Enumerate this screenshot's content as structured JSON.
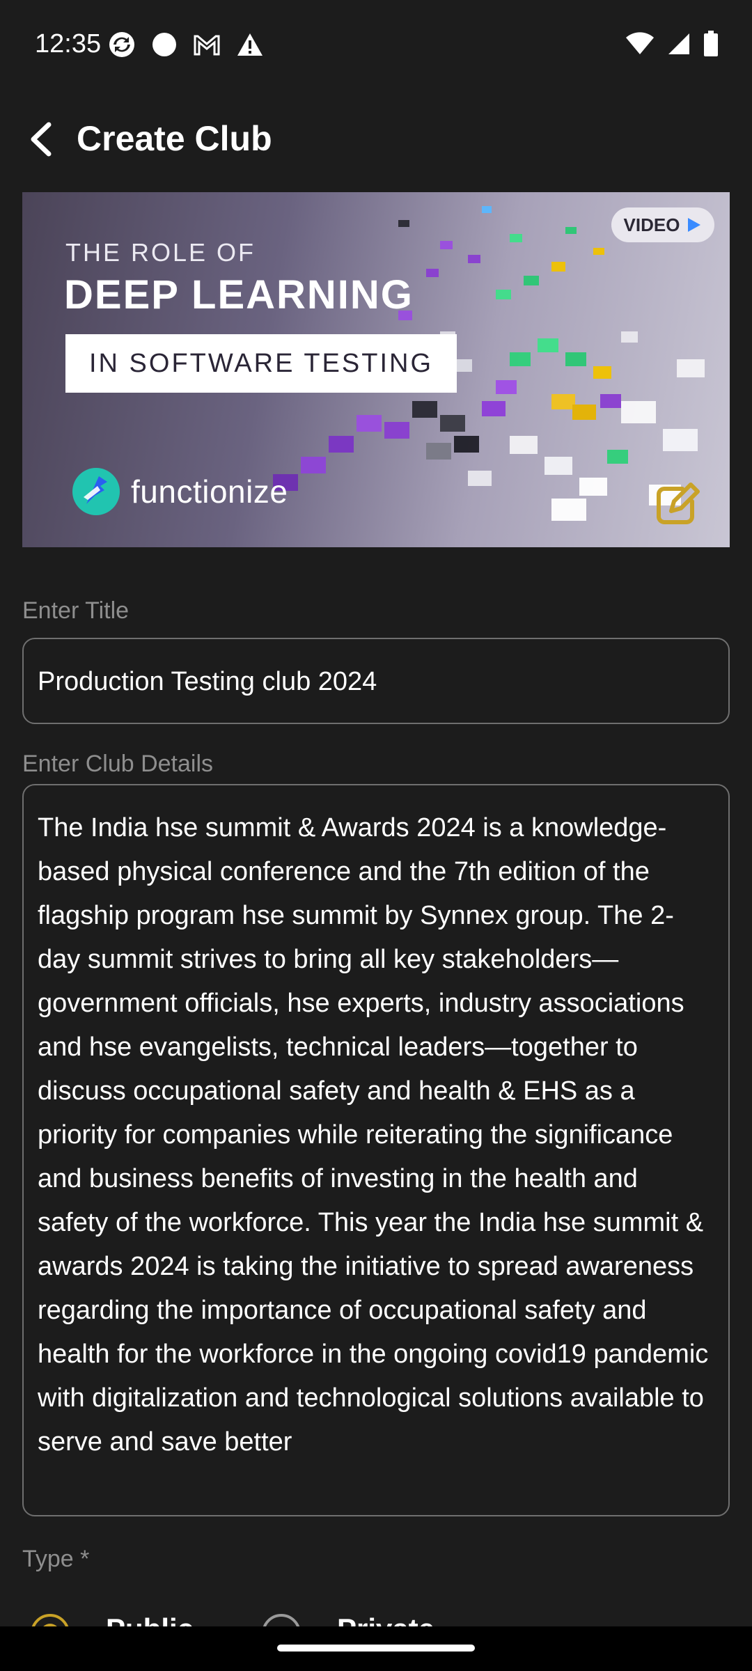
{
  "status_bar": {
    "time": "12:35",
    "left_icons": [
      "sync-icon",
      "circle-icon",
      "gmail-icon",
      "alert-icon"
    ],
    "right_icons": [
      "wifi-icon",
      "signal-icon",
      "battery-icon"
    ]
  },
  "app_bar": {
    "back_icon": "arrow-back-icon",
    "title": "Create Club"
  },
  "banner": {
    "line1": "THE ROLE OF",
    "line2": "DEEP LEARNING",
    "line3": "IN SOFTWARE TESTING",
    "badge": "VIDEO",
    "brand": "functionize",
    "edit_icon": "edit-icon"
  },
  "form": {
    "title_label": "Enter Title",
    "title_value": "Production Testing club 2024",
    "details_label": "Enter Club Details",
    "details_value": "The India hse summit & Awards 2024 is a knowledge-based physical conference and the 7th edition of the flagship program hse summit by Synnex group. The 2-day summit strives to bring all key stakeholders—government officials, hse experts, industry associations and hse evangelists, technical leaders—together to discuss occupational safety and health & EHS as a priority for companies while reiterating the significance and business benefits of investing in the health and safety of the workforce. This year the India hse summit & awards 2024 is taking the initiative to spread awareness regarding the importance of occupational safety and health for the workforce in the ongoing covid19 pandemic with digitalization and technological solutions available to serve and save better",
    "type_label": "Type *",
    "type_options": [
      "Public",
      "Private"
    ],
    "type_selected": "Public"
  },
  "colors": {
    "background": "#1c1c1c",
    "accent": "#c9a227",
    "label": "#8e8e8e",
    "border": "#6f6f6f"
  }
}
